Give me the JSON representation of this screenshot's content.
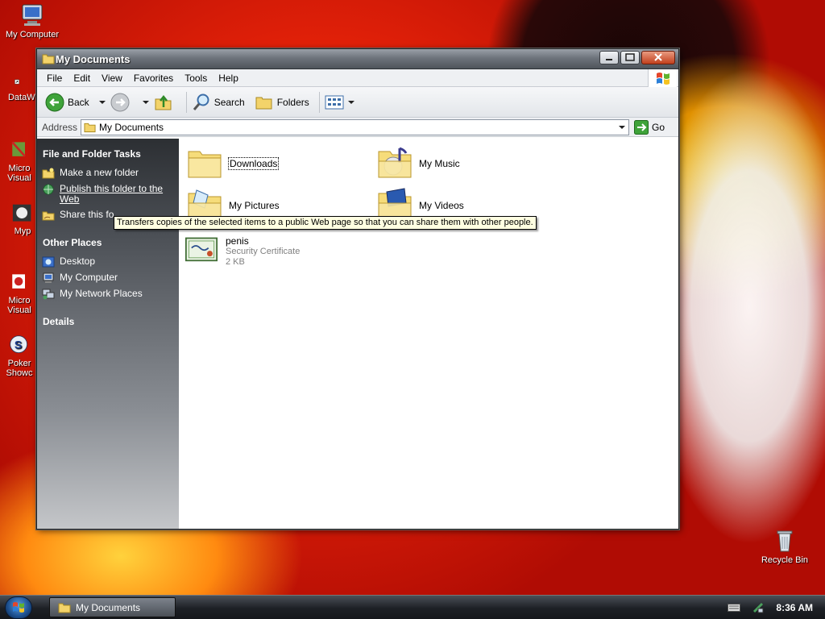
{
  "desktop": {
    "icons": [
      {
        "label": "My Computer"
      },
      {
        "label": "DataWi"
      },
      {
        "label": "Micro Visual"
      },
      {
        "label": "Myp"
      },
      {
        "label": "Micro Visual"
      },
      {
        "label": "Poker Showc"
      },
      {
        "label": "Recycle Bin"
      }
    ]
  },
  "window": {
    "title": "My Documents",
    "menu": [
      "File",
      "Edit",
      "View",
      "Favorites",
      "Tools",
      "Help"
    ],
    "toolbar": {
      "back": "Back",
      "search": "Search",
      "folders": "Folders"
    },
    "address": {
      "label": "Address",
      "value": "My Documents",
      "go": "Go"
    },
    "taskpane": {
      "file_tasks": {
        "title": "File and Folder Tasks",
        "items": [
          "Make a new folder",
          "Publish this folder to the Web",
          "Share this fo"
        ]
      },
      "other_places": {
        "title": "Other Places",
        "items": [
          "Desktop",
          "My Computer",
          "My Network Places"
        ]
      },
      "details": {
        "title": "Details"
      }
    },
    "files": [
      {
        "name": "Downloads"
      },
      {
        "name": "My Music"
      },
      {
        "name": "My Pictures"
      },
      {
        "name": "My Videos"
      },
      {
        "name": "penis",
        "type": "Security Certificate",
        "size": "2 KB"
      }
    ],
    "tooltip": "Transfers copies of the selected items to a public Web page so that you can share them with other people."
  },
  "taskbar": {
    "task_label": "My Documents",
    "clock": "8:36 AM"
  }
}
